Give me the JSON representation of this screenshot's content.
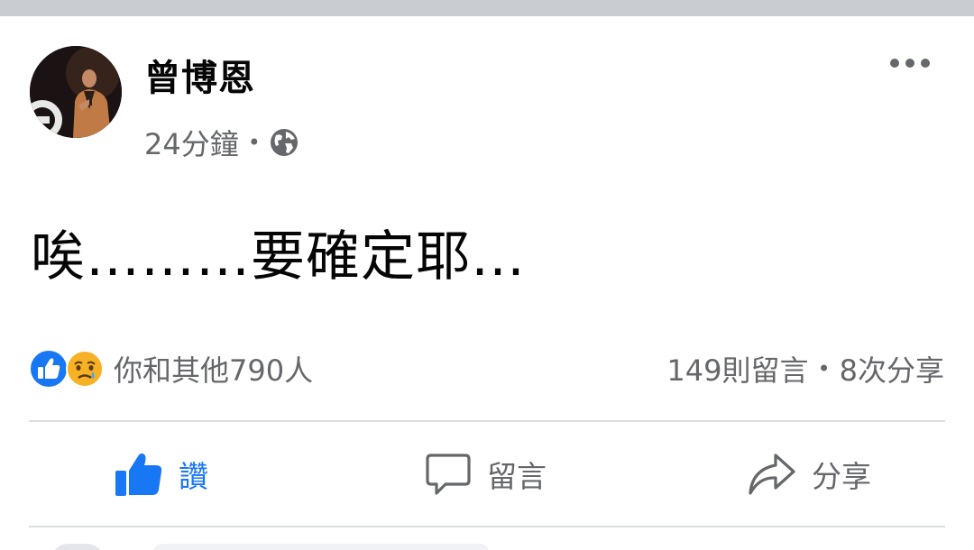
{
  "post": {
    "author": "曾博恩",
    "time": "24分鐘",
    "meta_separator": "•",
    "privacy_icon": "globe-icon",
    "text": "唉………要確定耶…"
  },
  "reactions": {
    "icons": [
      "like-reaction-icon",
      "sad-reaction-icon"
    ],
    "summary": "你和其他790人"
  },
  "stats": {
    "comments": "149則留言",
    "separator": "•",
    "shares": "8次分享"
  },
  "actions": {
    "like_label": "讚",
    "comment_label": "留言",
    "share_label": "分享"
  },
  "colors": {
    "like_blue": "#1877f2",
    "secondary_text": "#65676b",
    "divider": "#dadde1",
    "sad_yellow": "#f7b125"
  }
}
